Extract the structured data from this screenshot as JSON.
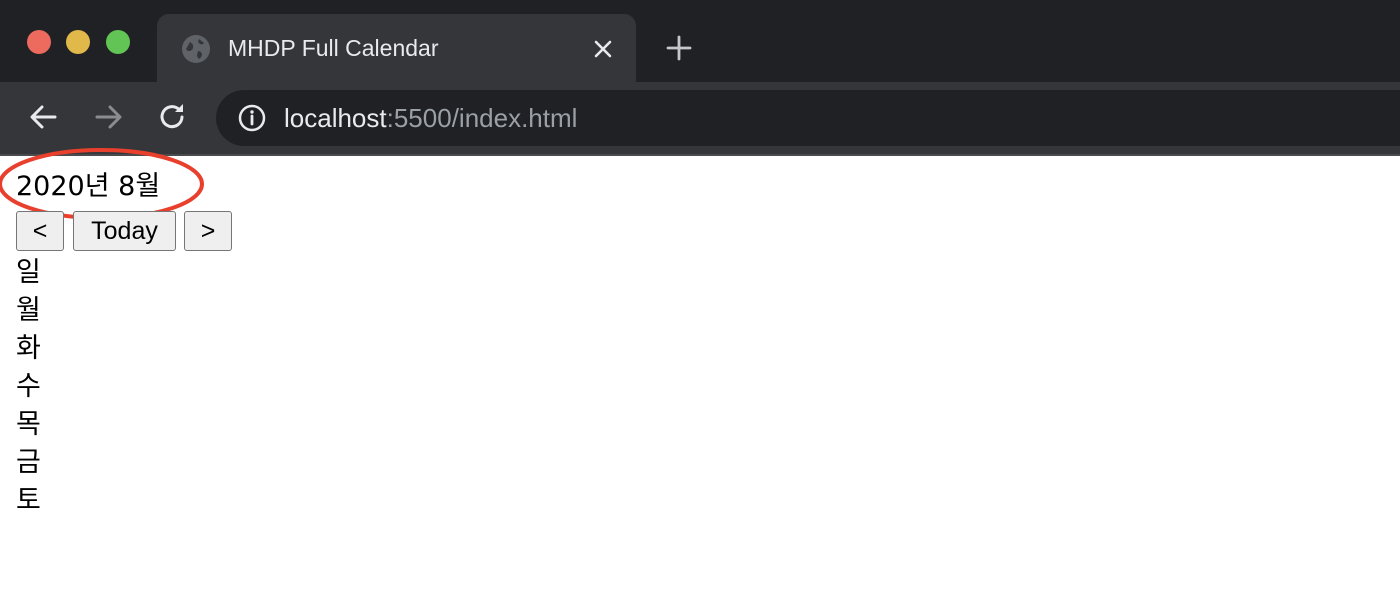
{
  "browser": {
    "tab": {
      "title": "MHDP Full Calendar",
      "favicon": "globe-icon"
    },
    "address_bar": {
      "host": "localhost",
      "rest": ":5500/index.html",
      "security_icon": "info-icon"
    },
    "colors": {
      "close_red": "#ed6a5e",
      "minimize_yellow": "#e1b84a",
      "zoom_green": "#62c454",
      "tab_bg": "#35363a",
      "frame_bg": "#202124"
    }
  },
  "calendar": {
    "title": "2020년 8월",
    "buttons": {
      "prev": "<",
      "today": "Today",
      "next": ">"
    },
    "weekdays": [
      "일",
      "월",
      "화",
      "수",
      "목",
      "금",
      "토"
    ],
    "annotation": {
      "shape": "ellipse",
      "color": "#e8402c"
    }
  }
}
